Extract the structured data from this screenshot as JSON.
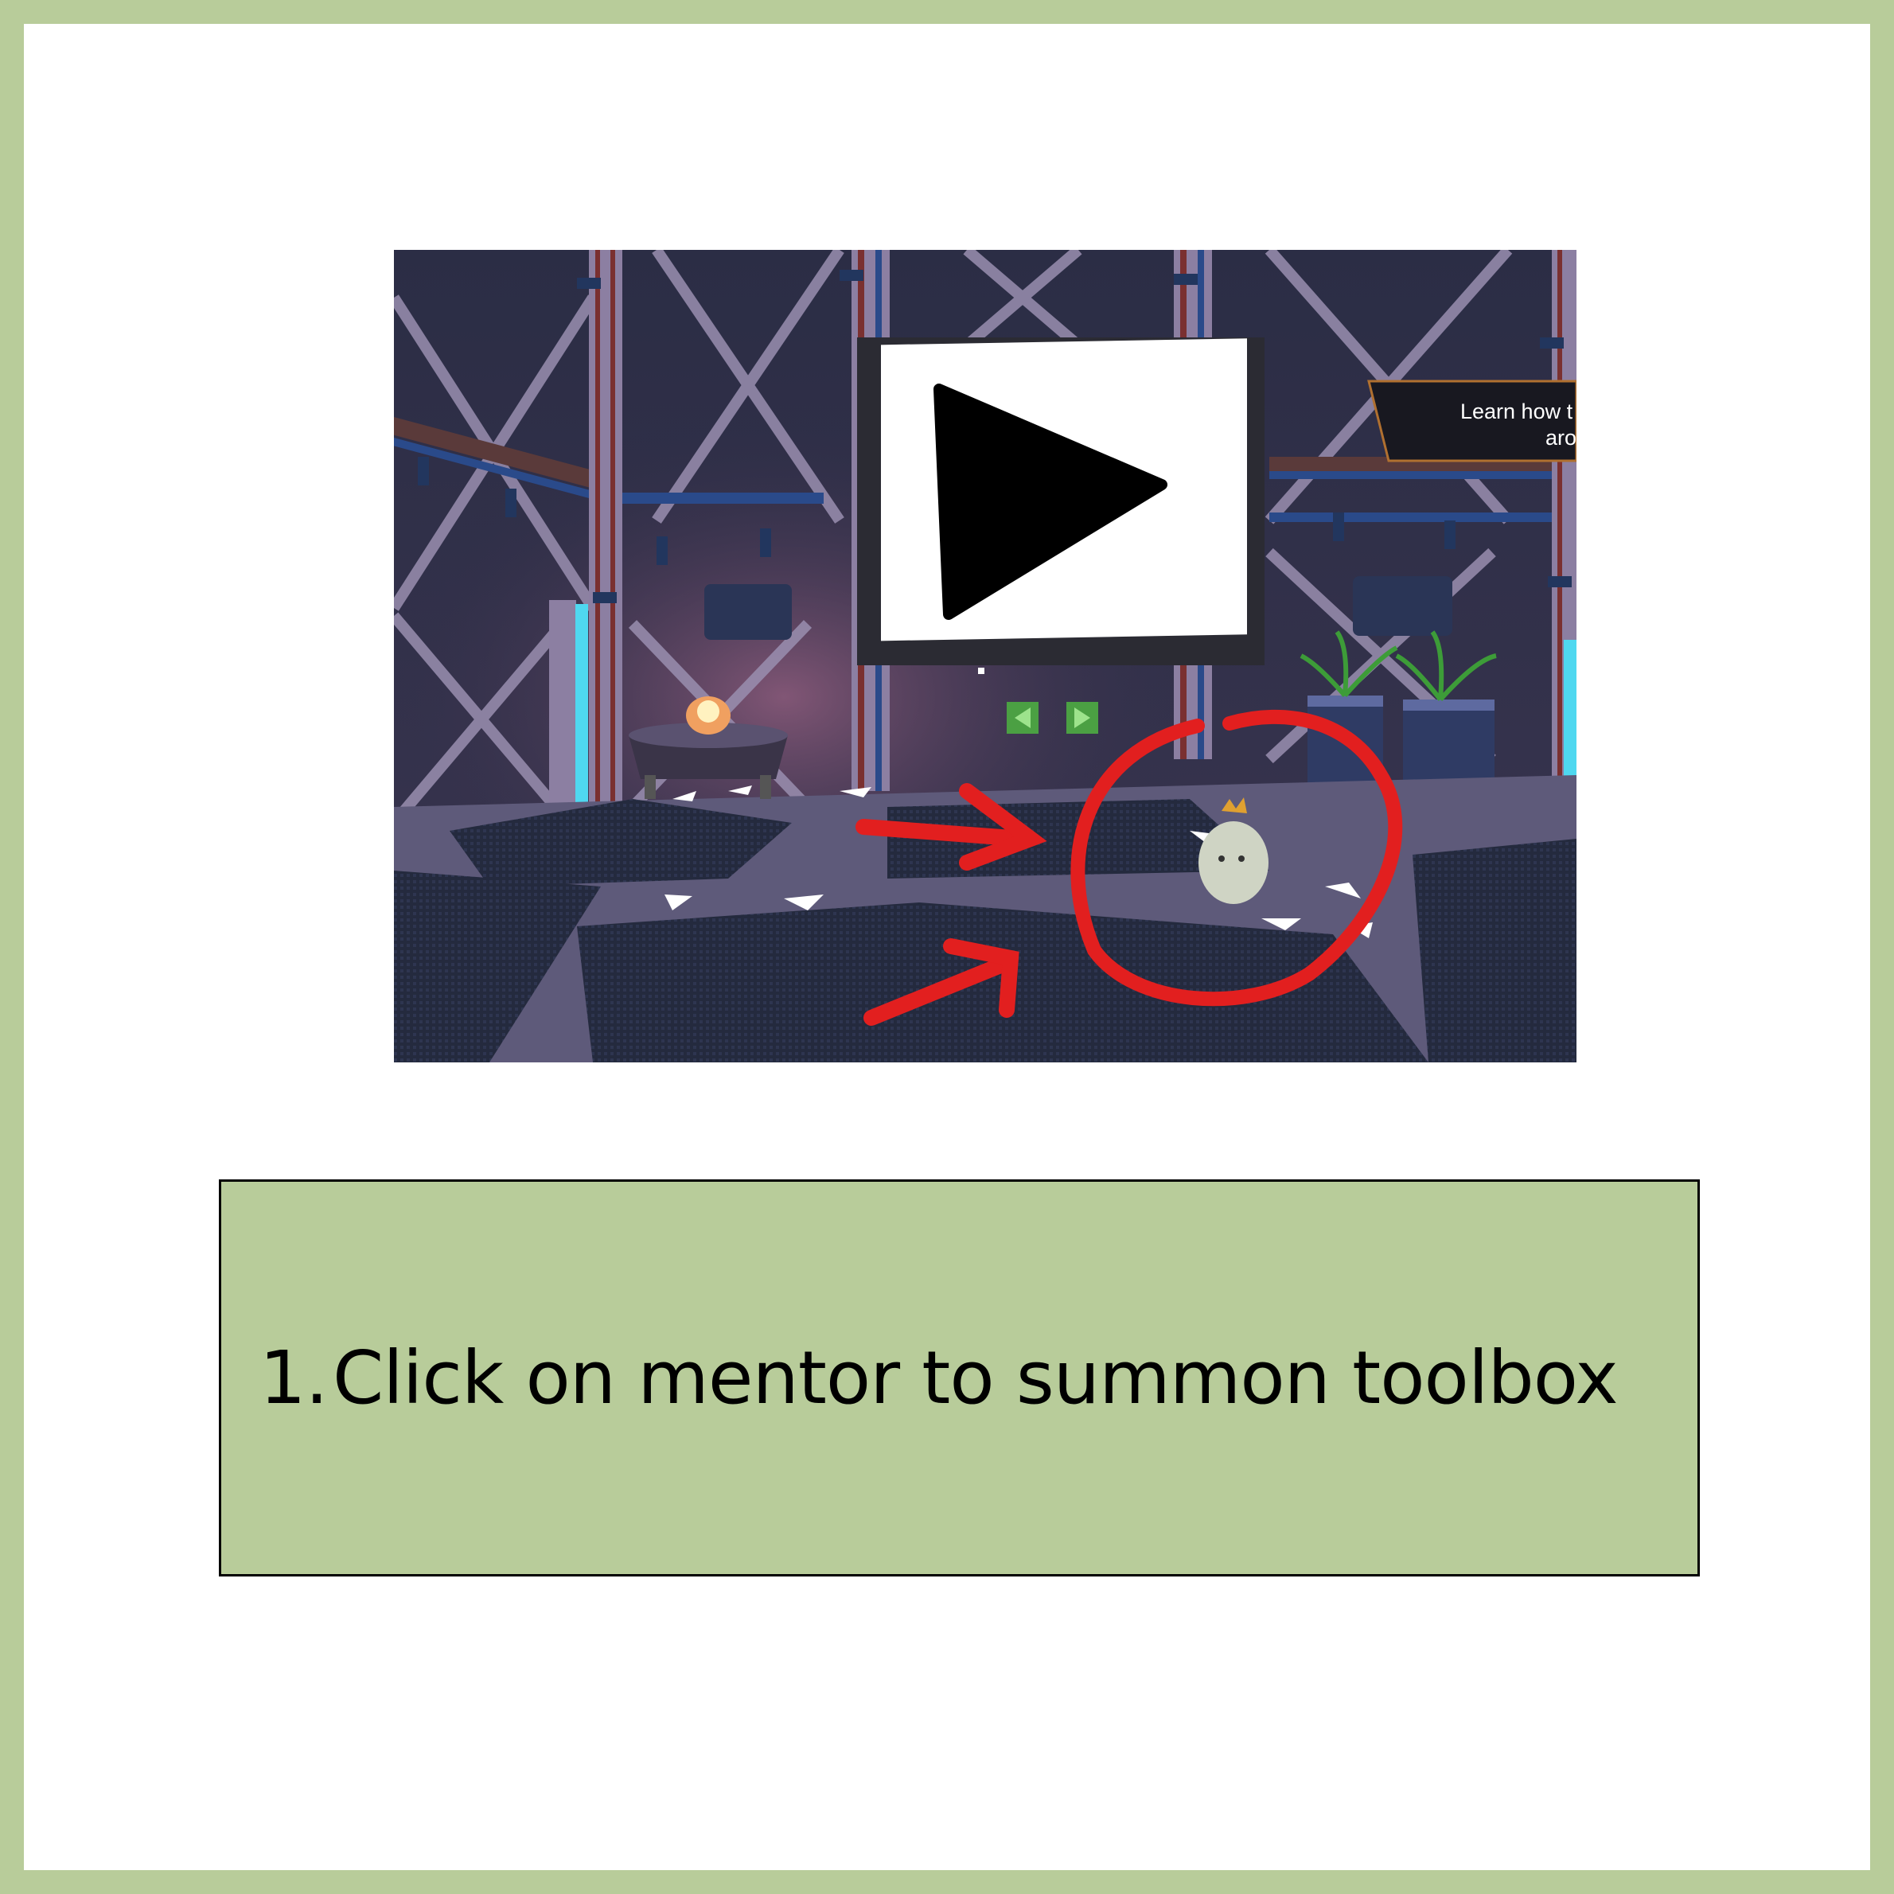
{
  "scene": {
    "sign_text_line1": "Learn how t",
    "sign_text_line2": "aro",
    "play_icon": "play-icon",
    "nav_icons": [
      "arrow-left-icon",
      "arrow-right-icon"
    ],
    "annotation_color": "#e21f1f"
  },
  "instruction": {
    "number": "1.",
    "text": "Click on mentor to summon toolbox"
  },
  "colors": {
    "frame": "#b8cc9a",
    "caption_bg": "#b8cc9a",
    "page_bg": "#ffffff"
  }
}
